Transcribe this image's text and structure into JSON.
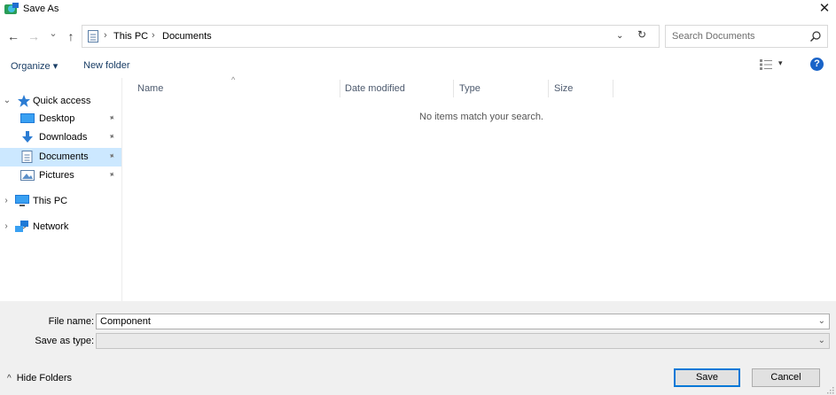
{
  "window": {
    "title": "Save As",
    "close_glyph": "✕"
  },
  "nav": {
    "back": "←",
    "forward": "→",
    "recent": "⌄",
    "up": "↑"
  },
  "address": {
    "crumbs": [
      "This PC",
      "Documents"
    ],
    "separator": "›",
    "dropdown": "⌄",
    "refresh": "↻"
  },
  "search": {
    "placeholder": "Search Documents"
  },
  "toolbar": {
    "organize": "Organize ▾",
    "new_folder": "New folder",
    "view_caret": "▾",
    "help": "?"
  },
  "sidebar": {
    "quick_access": "Quick access",
    "items": [
      {
        "label": "Desktop",
        "icon": "desktop-icon",
        "pinned": true
      },
      {
        "label": "Downloads",
        "icon": "downloads-icon",
        "pinned": true
      },
      {
        "label": "Documents",
        "icon": "documents-icon",
        "pinned": true,
        "selected": true
      },
      {
        "label": "Pictures",
        "icon": "pictures-icon",
        "pinned": true
      }
    ],
    "this_pc": "This PC",
    "network": "Network",
    "expanded_glyph": "⌄",
    "collapsed_glyph": "›",
    "pin_glyph": "📌"
  },
  "columns": [
    "Name",
    "Date modified",
    "Type",
    "Size"
  ],
  "sort_caret": "^",
  "empty_message": "No items match your search.",
  "form": {
    "file_name_label": "File name:",
    "file_name_value": "Component",
    "save_as_type_label": "Save as type:",
    "save_as_type_value": "",
    "caret": "⌄"
  },
  "footer": {
    "hide_folders": "Hide Folders",
    "hide_chev": "^",
    "save": "Save",
    "cancel": "Cancel"
  },
  "colors": {
    "selected_bg": "#cce8ff",
    "accent": "#0078d7",
    "help_bg": "#1a64c8",
    "bottom_bg": "#f0f0f0"
  }
}
